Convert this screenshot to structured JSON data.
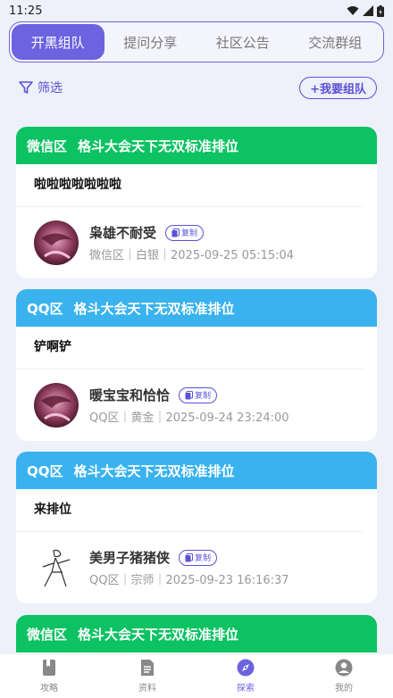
{
  "status": {
    "time": "11:25"
  },
  "tabs": [
    {
      "label": "开黑组队",
      "active": true
    },
    {
      "label": "提问分享",
      "active": false
    },
    {
      "label": "社区公告",
      "active": false
    },
    {
      "label": "交流群组",
      "active": false
    }
  ],
  "filter": {
    "label": "筛选",
    "team_button": "+我要组队"
  },
  "posts": [
    {
      "region": "微信区",
      "title": "格斗大会天下无双标准排位",
      "header_color": "#0cc262",
      "content": "啦啦啦啦啦啦啦",
      "username": "枭雄不耐受",
      "copy_label": "复制",
      "meta": "微信区｜白银｜2025-09-25 05:15:04",
      "avatar_icon": "avatar-portrait"
    },
    {
      "region": "QQ区",
      "title": "格斗大会天下无双标准排位",
      "header_color": "#39b2ee",
      "content": "铲啊铲",
      "username": "暖宝宝和恰恰",
      "copy_label": "复制",
      "meta": "QQ区｜黄金｜2025-09-24 23:24:00",
      "avatar_icon": "avatar-portrait"
    },
    {
      "region": "QQ区",
      "title": "格斗大会天下无双标准排位",
      "header_color": "#39b2ee",
      "content": "来排位",
      "username": "美男子猪猪侠",
      "copy_label": "复制",
      "meta": "QQ区｜宗师｜2025-09-23 16:16:37",
      "avatar_icon": "avatar-sketch"
    },
    {
      "region": "微信区",
      "title": "格斗大会天下无双标准排位",
      "header_color": "#0cc262"
    }
  ],
  "nav": [
    {
      "label": "攻略",
      "icon": "book-icon",
      "active": false
    },
    {
      "label": "资料",
      "icon": "document-icon",
      "active": false
    },
    {
      "label": "探索",
      "icon": "compass-icon",
      "active": true
    },
    {
      "label": "我的",
      "icon": "user-icon",
      "active": false
    }
  ]
}
